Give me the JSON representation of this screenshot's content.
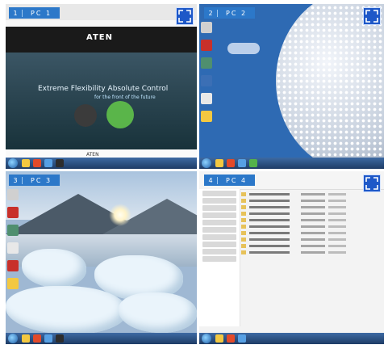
{
  "quadrants": [
    {
      "number": "1",
      "label": "PC 1"
    },
    {
      "number": "2",
      "label": "PC 2"
    },
    {
      "number": "3",
      "label": "PC 3"
    },
    {
      "number": "4",
      "label": "PC 4"
    }
  ],
  "browser": {
    "logo": "ATEN",
    "hero_title": "Extreme Flexibility Absolute Control",
    "hero_subtitle": "for the front of the future",
    "footer_logo": "ATEN"
  },
  "colors": {
    "badge": "#2c78c9",
    "corner_button": "#1e58c8",
    "taskbar": "#1e3c66"
  },
  "icons": [
    "fullscreen-icon",
    "windows-start-icon",
    "folder-icon",
    "browser-icon"
  ]
}
